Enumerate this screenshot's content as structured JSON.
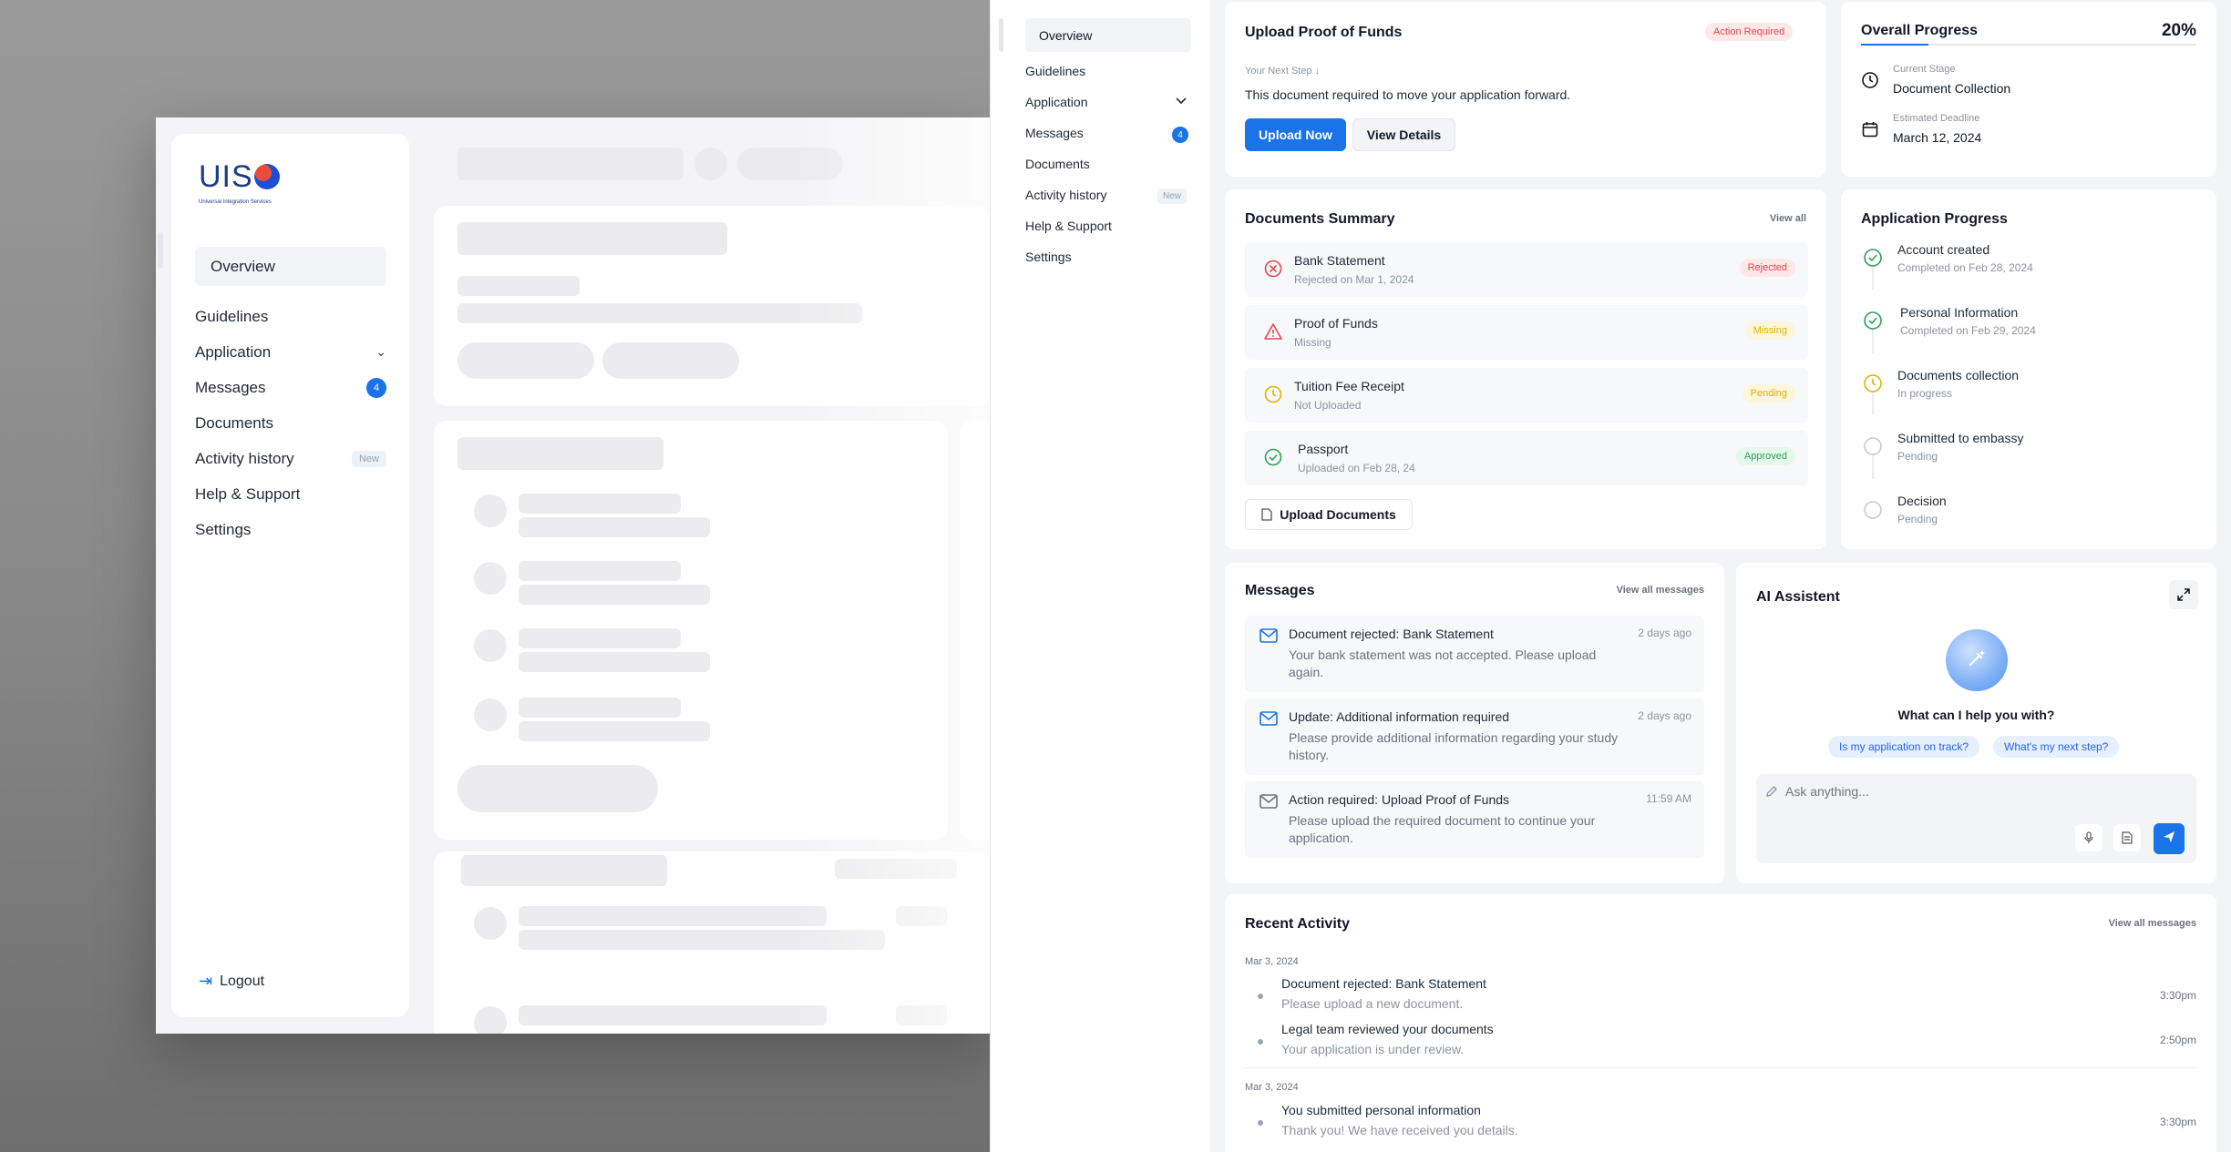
{
  "mockup": {
    "logo_text": "UIS",
    "logo_sub": "Universal Integration Services",
    "nav": [
      {
        "label": "Overview"
      },
      {
        "label": "Guidelines"
      },
      {
        "label": "Application"
      },
      {
        "label": "Messages",
        "badge": "4"
      },
      {
        "label": "Documents"
      },
      {
        "label": "Activity history",
        "tag": "New"
      },
      {
        "label": "Help & Support"
      },
      {
        "label": "Settings"
      }
    ],
    "logout": "Logout"
  },
  "sidebar": {
    "items": [
      {
        "label": "Overview"
      },
      {
        "label": "Guidelines"
      },
      {
        "label": "Application"
      },
      {
        "label": "Messages",
        "badge": "4"
      },
      {
        "label": "Documents"
      },
      {
        "label": "Activity history",
        "tag": "New"
      },
      {
        "label": "Help & Support"
      },
      {
        "label": "Settings"
      }
    ]
  },
  "upload_card": {
    "title": "Upload Proof of Funds",
    "status": "Action Required",
    "next_step_label": "Your Next Step ↓",
    "description": "This document required to move your application forward.",
    "primary_button": "Upload Now",
    "secondary_button": "View Details"
  },
  "overall_progress": {
    "title": "Overall Progress",
    "percent_label": "20%",
    "percent_value": 20,
    "current_stage_label": "Current Stage",
    "current_stage_value": "Document Collection",
    "deadline_label": "Estimated Deadline",
    "deadline_value": "March 12, 2024"
  },
  "documents_summary": {
    "title": "Documents Summary",
    "view_all": "View all",
    "items": [
      {
        "name": "Bank Statement",
        "sub": "Rejected on Mar 1, 2024",
        "status": "Rejected",
        "icon": "x-circle-icon"
      },
      {
        "name": "Proof of Funds",
        "sub": "Missing",
        "status": "Missing",
        "icon": "warning-triangle-icon"
      },
      {
        "name": "Tuition Fee Receipt",
        "sub": "Not Uploaded",
        "status": "Pending",
        "icon": "clock-icon"
      },
      {
        "name": "Passport",
        "sub": "Uploaded on Feb 28, 24",
        "status": "Approved",
        "icon": "check-circle-icon"
      }
    ],
    "upload_button": "Upload Documents"
  },
  "application_progress": {
    "title": "Application Progress",
    "steps": [
      {
        "title": "Account created",
        "sub": "Completed on Feb 28, 2024",
        "state": "done"
      },
      {
        "title": "Personal Information",
        "sub": "Completed on Feb 29, 2024",
        "state": "done"
      },
      {
        "title": "Documents collection",
        "sub": "In progress",
        "state": "current"
      },
      {
        "title": "Submitted to embassy",
        "sub": "Pending",
        "state": "pending"
      },
      {
        "title": "Decision",
        "sub": "Pending",
        "state": "pending"
      }
    ]
  },
  "messages": {
    "title": "Messages",
    "view_all": "View all messages",
    "items": [
      {
        "title": "Document rejected: Bank Statement",
        "body": "Your bank statement was not accepted. Please upload again.",
        "time": "2 days ago"
      },
      {
        "title": "Update: Additional information required",
        "body": "Please provide additional information regarding your study history.",
        "time": "2 days ago"
      },
      {
        "title": "Action required: Upload Proof of Funds",
        "body": "Please upload the required document to continue your application.",
        "time": "11:59 AM"
      }
    ]
  },
  "assistant": {
    "title": "AI Assistent",
    "prompt": "What can I help you with?",
    "suggestions": [
      "Is my application on track?",
      "What's my next step?"
    ],
    "placeholder": "Ask anything..."
  },
  "recent_activity": {
    "title": "Recent Activity",
    "view_all": "View all messages",
    "groups": [
      {
        "date": "Mar 3, 2024",
        "items": [
          {
            "title": "Document rejected: Bank Statement",
            "sub": "Please upload a new document.",
            "time": "3:30pm"
          },
          {
            "title": "Legal team reviewed your documents",
            "sub": "Your application is under review.",
            "time": "2:50pm"
          }
        ]
      },
      {
        "date": "Mar 3, 2024",
        "items": [
          {
            "title": "You submitted personal information",
            "sub": "Thank you! We have received you details.",
            "time": "3:30pm"
          }
        ]
      }
    ]
  },
  "colors": {
    "accent": "#1a73e8",
    "rejected": "#e5484d",
    "pending": "#e0b400",
    "approved": "#2ea05b"
  }
}
